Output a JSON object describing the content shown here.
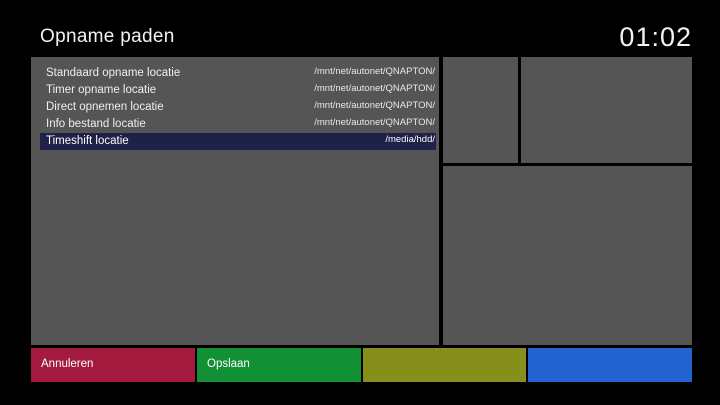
{
  "header": {
    "title": "Opname paden",
    "clock": "01:02"
  },
  "settings": [
    {
      "label": "Standaard opname locatie",
      "value": "/mnt/net/autonet/QNAPTON/"
    },
    {
      "label": "Timer opname locatie",
      "value": "/mnt/net/autonet/QNAPTON/"
    },
    {
      "label": "Direct opnemen locatie",
      "value": "/mnt/net/autonet/QNAPTON/"
    },
    {
      "label": "Info bestand locatie",
      "value": "/mnt/net/autonet/QNAPTON/"
    },
    {
      "label": "Timeshift locatie",
      "value": "/media/hdd/",
      "selected": true
    }
  ],
  "buttons": {
    "red": "Annuleren",
    "green": "Opslaan",
    "yellow": "",
    "blue": ""
  },
  "colors": {
    "background": "#000000",
    "panel": "#555555",
    "selection": "#1e2148",
    "red": "#a31a3e",
    "green": "#129035",
    "yellow": "#868f1b",
    "blue": "#2063d1"
  }
}
